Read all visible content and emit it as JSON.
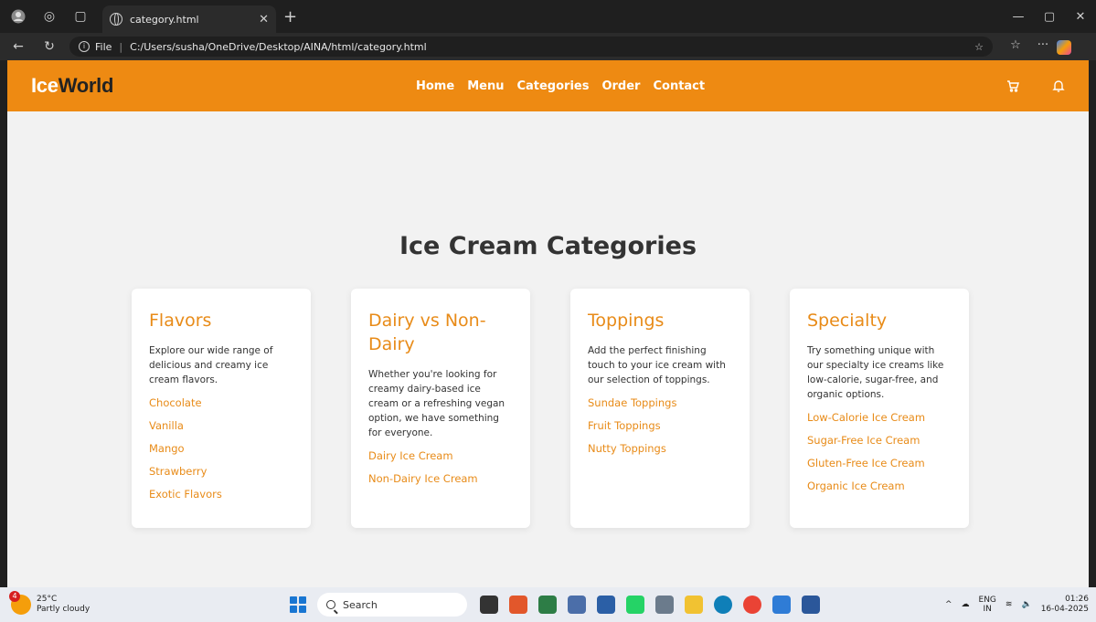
{
  "browser": {
    "tab_title": "category.html",
    "url_prefix": "File",
    "url": "C:/Users/susha/OneDrive/Desktop/AINA/html/category.html"
  },
  "site": {
    "logo_ice": "Ice",
    "logo_world": "World",
    "nav": [
      "Home",
      "Menu",
      "Categories",
      "Order",
      "Contact"
    ],
    "colors": {
      "header": "#ee8a12",
      "accent": "#e88b18",
      "background": "#f2f2f2"
    }
  },
  "page": {
    "title": "Ice Cream Categories",
    "cards": [
      {
        "title": "Flavors",
        "description": "Explore our wide range of delicious and creamy ice cream flavors.",
        "links": [
          "Chocolate",
          "Vanilla",
          "Mango",
          "Strawberry",
          "Exotic Flavors"
        ]
      },
      {
        "title": "Dairy vs Non-Dairy",
        "description": "Whether you're looking for creamy dairy-based ice cream or a refreshing vegan option, we have something for everyone.",
        "links": [
          "Dairy Ice Cream",
          "Non-Dairy Ice Cream"
        ]
      },
      {
        "title": "Toppings",
        "description": "Add the perfect finishing touch to your ice cream with our selection of toppings.",
        "links": [
          "Sundae Toppings",
          "Fruit Toppings",
          "Nutty Toppings"
        ]
      },
      {
        "title": "Specialty",
        "description": "Try something unique with our specialty ice creams like low-calorie, sugar-free, and organic options.",
        "links": [
          "Low-Calorie Ice Cream",
          "Sugar-Free Ice Cream",
          "Gluten-Free Ice Cream",
          "Organic Ice Cream"
        ]
      }
    ]
  },
  "taskbar": {
    "weather_badge": "4",
    "temperature": "25°C",
    "weather": "Partly cloudy",
    "search": "Search",
    "lang_1": "ENG",
    "lang_2": "IN",
    "time": "01:26",
    "date": "16-04-2025"
  }
}
